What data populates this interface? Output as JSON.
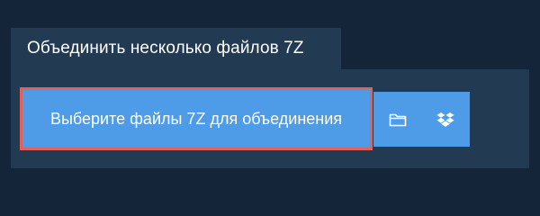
{
  "tab": {
    "title": "Объединить несколько файлов 7Z"
  },
  "uploader": {
    "select_button_label": "Выберите файлы 7Z для объединения",
    "folder_icon": "folder-icon",
    "dropbox_icon": "dropbox-icon"
  },
  "colors": {
    "page_background": "#14253a",
    "panel_background": "#233a53",
    "button_background": "#4e9ce8",
    "highlight_border": "#e0625b",
    "text": "#ffffff"
  }
}
